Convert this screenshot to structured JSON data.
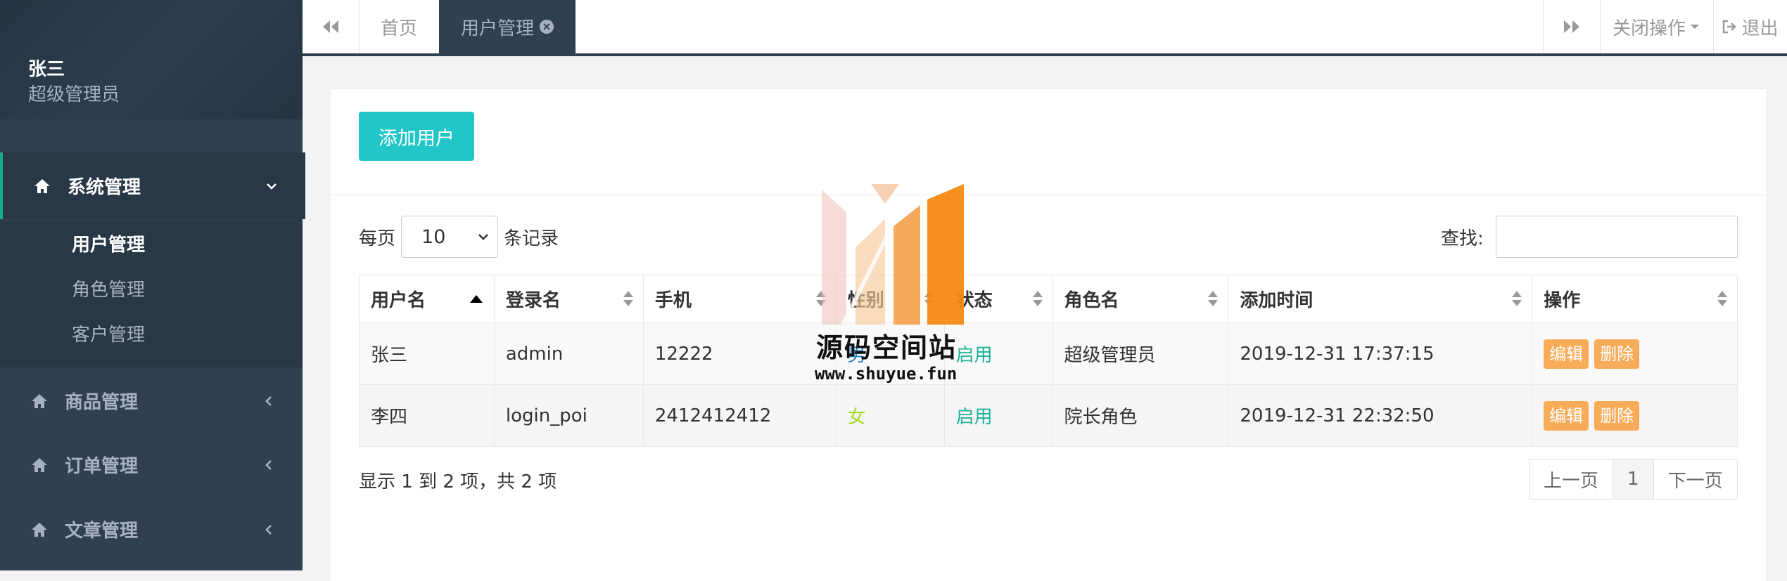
{
  "sidebar": {
    "user_name": "张三",
    "user_role": "超级管理员",
    "sections": [
      {
        "label": "系统管理",
        "icon": "home-icon",
        "chevron": "chevron-down-icon",
        "expanded": true
      },
      {
        "label": "商品管理",
        "icon": "home-icon",
        "chevron": "chevron-left-icon",
        "expanded": false
      },
      {
        "label": "订单管理",
        "icon": "home-icon",
        "chevron": "chevron-left-icon",
        "expanded": false
      },
      {
        "label": "文章管理",
        "icon": "home-icon",
        "chevron": "chevron-left-icon",
        "expanded": false
      }
    ],
    "sub_items": [
      "用户管理",
      "角色管理",
      "客户管理"
    ]
  },
  "topbar": {
    "tab_home": "首页",
    "tab_current": "用户管理",
    "close_ops": "关闭操作",
    "logout": "退出"
  },
  "toolbar": {
    "add_user": "添加用户"
  },
  "table_controls": {
    "per_page_prefix": "每页",
    "per_page_value": "10",
    "per_page_suffix": "条记录",
    "search_label": "查找:"
  },
  "table": {
    "columns": [
      "用户名",
      "登录名",
      "手机",
      "性别",
      "状态",
      "角色名",
      "添加时间",
      "操作"
    ],
    "rows": [
      {
        "username": "张三",
        "login": "admin",
        "phone": "12222",
        "gender": "男",
        "status": "启用",
        "role": "超级管理员",
        "added": "2019-12-31 17:37:15",
        "edit": "编辑",
        "delete": "删除"
      },
      {
        "username": "李四",
        "login": "login_poi",
        "phone": "2412412412",
        "gender": "女",
        "status": "启用",
        "role": "院长角色",
        "added": "2019-12-31 22:32:50",
        "edit": "编辑",
        "delete": "删除"
      }
    ]
  },
  "footer": {
    "info": "显示 1 到 2 项，共 2 项",
    "prev": "上一页",
    "page": "1",
    "next": "下一页"
  },
  "watermark": {
    "title": "源码空间站",
    "url": "www.shuyue.fun"
  },
  "colors": {
    "sidebar_bg": "#2f4050",
    "add_button": "#23c6c8",
    "action_button": "#f8ac59",
    "status_enabled": "#1ab394",
    "gender_male": "#1c84c6",
    "gender_female": "#a5dc23"
  }
}
